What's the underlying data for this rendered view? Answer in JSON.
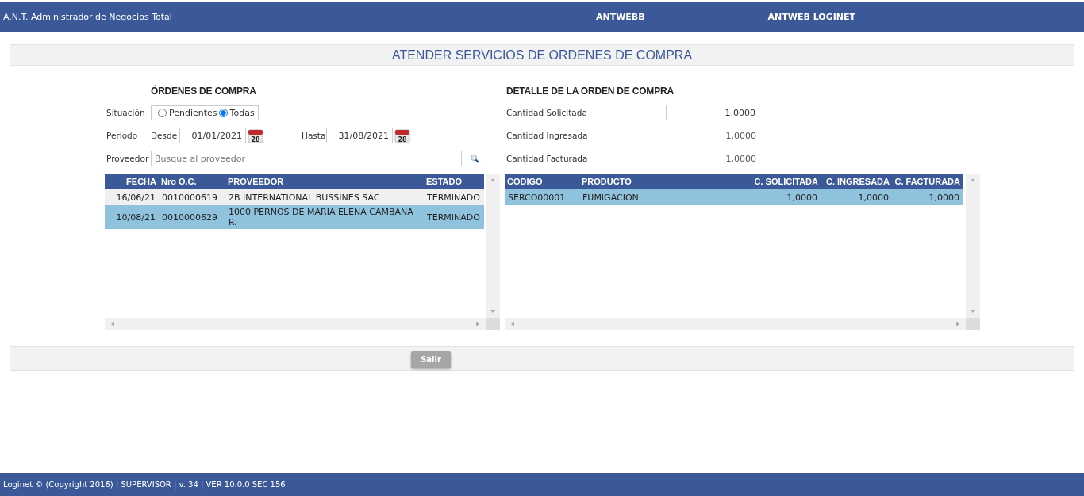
{
  "header": {
    "app_title": "A.N.T. Administrador de Negocios Total",
    "links": [
      "ANTWEBB",
      "ANTWEB LOGINET"
    ]
  },
  "page_title": "ATENDER SERVICIOS DE ORDENES DE COMPRA",
  "orders": {
    "heading": "ÓRDENES DE COMPRA",
    "situation": {
      "label": "Situación",
      "options": [
        {
          "label": "Pendientes",
          "selected": false
        },
        {
          "label": "Todas",
          "selected": true
        }
      ]
    },
    "period": {
      "label": "Periodo",
      "from": {
        "label": "Desde",
        "value": "01/01/2021",
        "calendar_day": "28"
      },
      "to": {
        "label": "Hasta",
        "value": "31/08/2021",
        "calendar_day": "28"
      }
    },
    "supplier": {
      "label": "Proveedor",
      "placeholder": "Busque al proveedor"
    },
    "table": {
      "columns": [
        "FECHA",
        "Nro O.C.",
        "PROVEEDOR",
        "ESTADO"
      ],
      "rows": [
        {
          "cells": [
            "16/06/21",
            "0010000619",
            "2B INTERNATIONAL BUSSINES SAC",
            "TERMINADO"
          ],
          "selected": false
        },
        {
          "cells": [
            "10/08/21",
            "0010000629",
            "1000 PERNOS DE MARIA ELENA CAMBANA R.",
            "TERMINADO"
          ],
          "selected": true
        }
      ]
    }
  },
  "detail": {
    "heading": "DETALLE DE LA ORDEN DE COMPRA",
    "fields": [
      {
        "label": "Cantidad Solicitada",
        "value": "1,0000",
        "kind": "input"
      },
      {
        "label": "Cantidad Ingresada",
        "value": "1,0000",
        "kind": "text"
      },
      {
        "label": "Cantidad Facturada",
        "value": "1,0000",
        "kind": "text"
      }
    ],
    "table": {
      "columns": [
        "CODIGO",
        "PRODUCTO",
        "C. SOLICITADA",
        "C. INGRESADA",
        "C. FACTURADA"
      ],
      "rows": [
        {
          "cells": [
            "SERCO00001",
            "FUMIGACION",
            "1,0000",
            "1,0000",
            "1,0000"
          ],
          "selected": true
        }
      ]
    }
  },
  "buttons": [
    "Salir"
  ],
  "status_bar": "Loginet © (Copyright 2016) | SUPERVISOR | v. 34 | VER 10.0.0 SEC 156"
}
